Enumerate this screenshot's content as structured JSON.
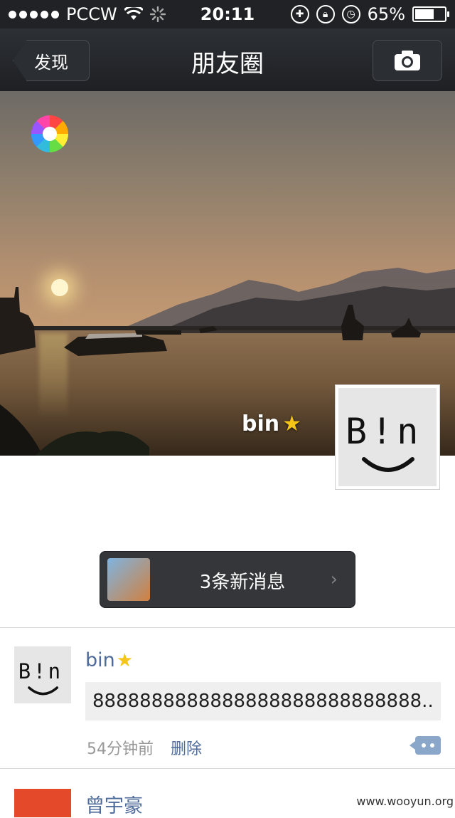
{
  "status_bar": {
    "carrier": "PCCW",
    "time": "20:11",
    "battery_text": "65%",
    "battery_level": 0.65
  },
  "navbar": {
    "back_label": "发现",
    "title": "朋友圈",
    "camera_icon": "camera-icon"
  },
  "cover": {
    "user_name": "bin",
    "badge_icon": "star-icon",
    "avatar_text": "B!n"
  },
  "new_messages": {
    "label": "3条新消息"
  },
  "posts": [
    {
      "author": "bin",
      "avatar_text": "B!n",
      "content": "8888888888888888888888888888..",
      "time": "54分钟前",
      "delete_label": "删除"
    },
    {
      "author": "曾宇豪"
    }
  ],
  "watermark": "www.wooyun.org",
  "colors": {
    "nav_bg": "#202225",
    "link_blue": "#4e6b9a",
    "comment_button": "#8aa6c8"
  }
}
